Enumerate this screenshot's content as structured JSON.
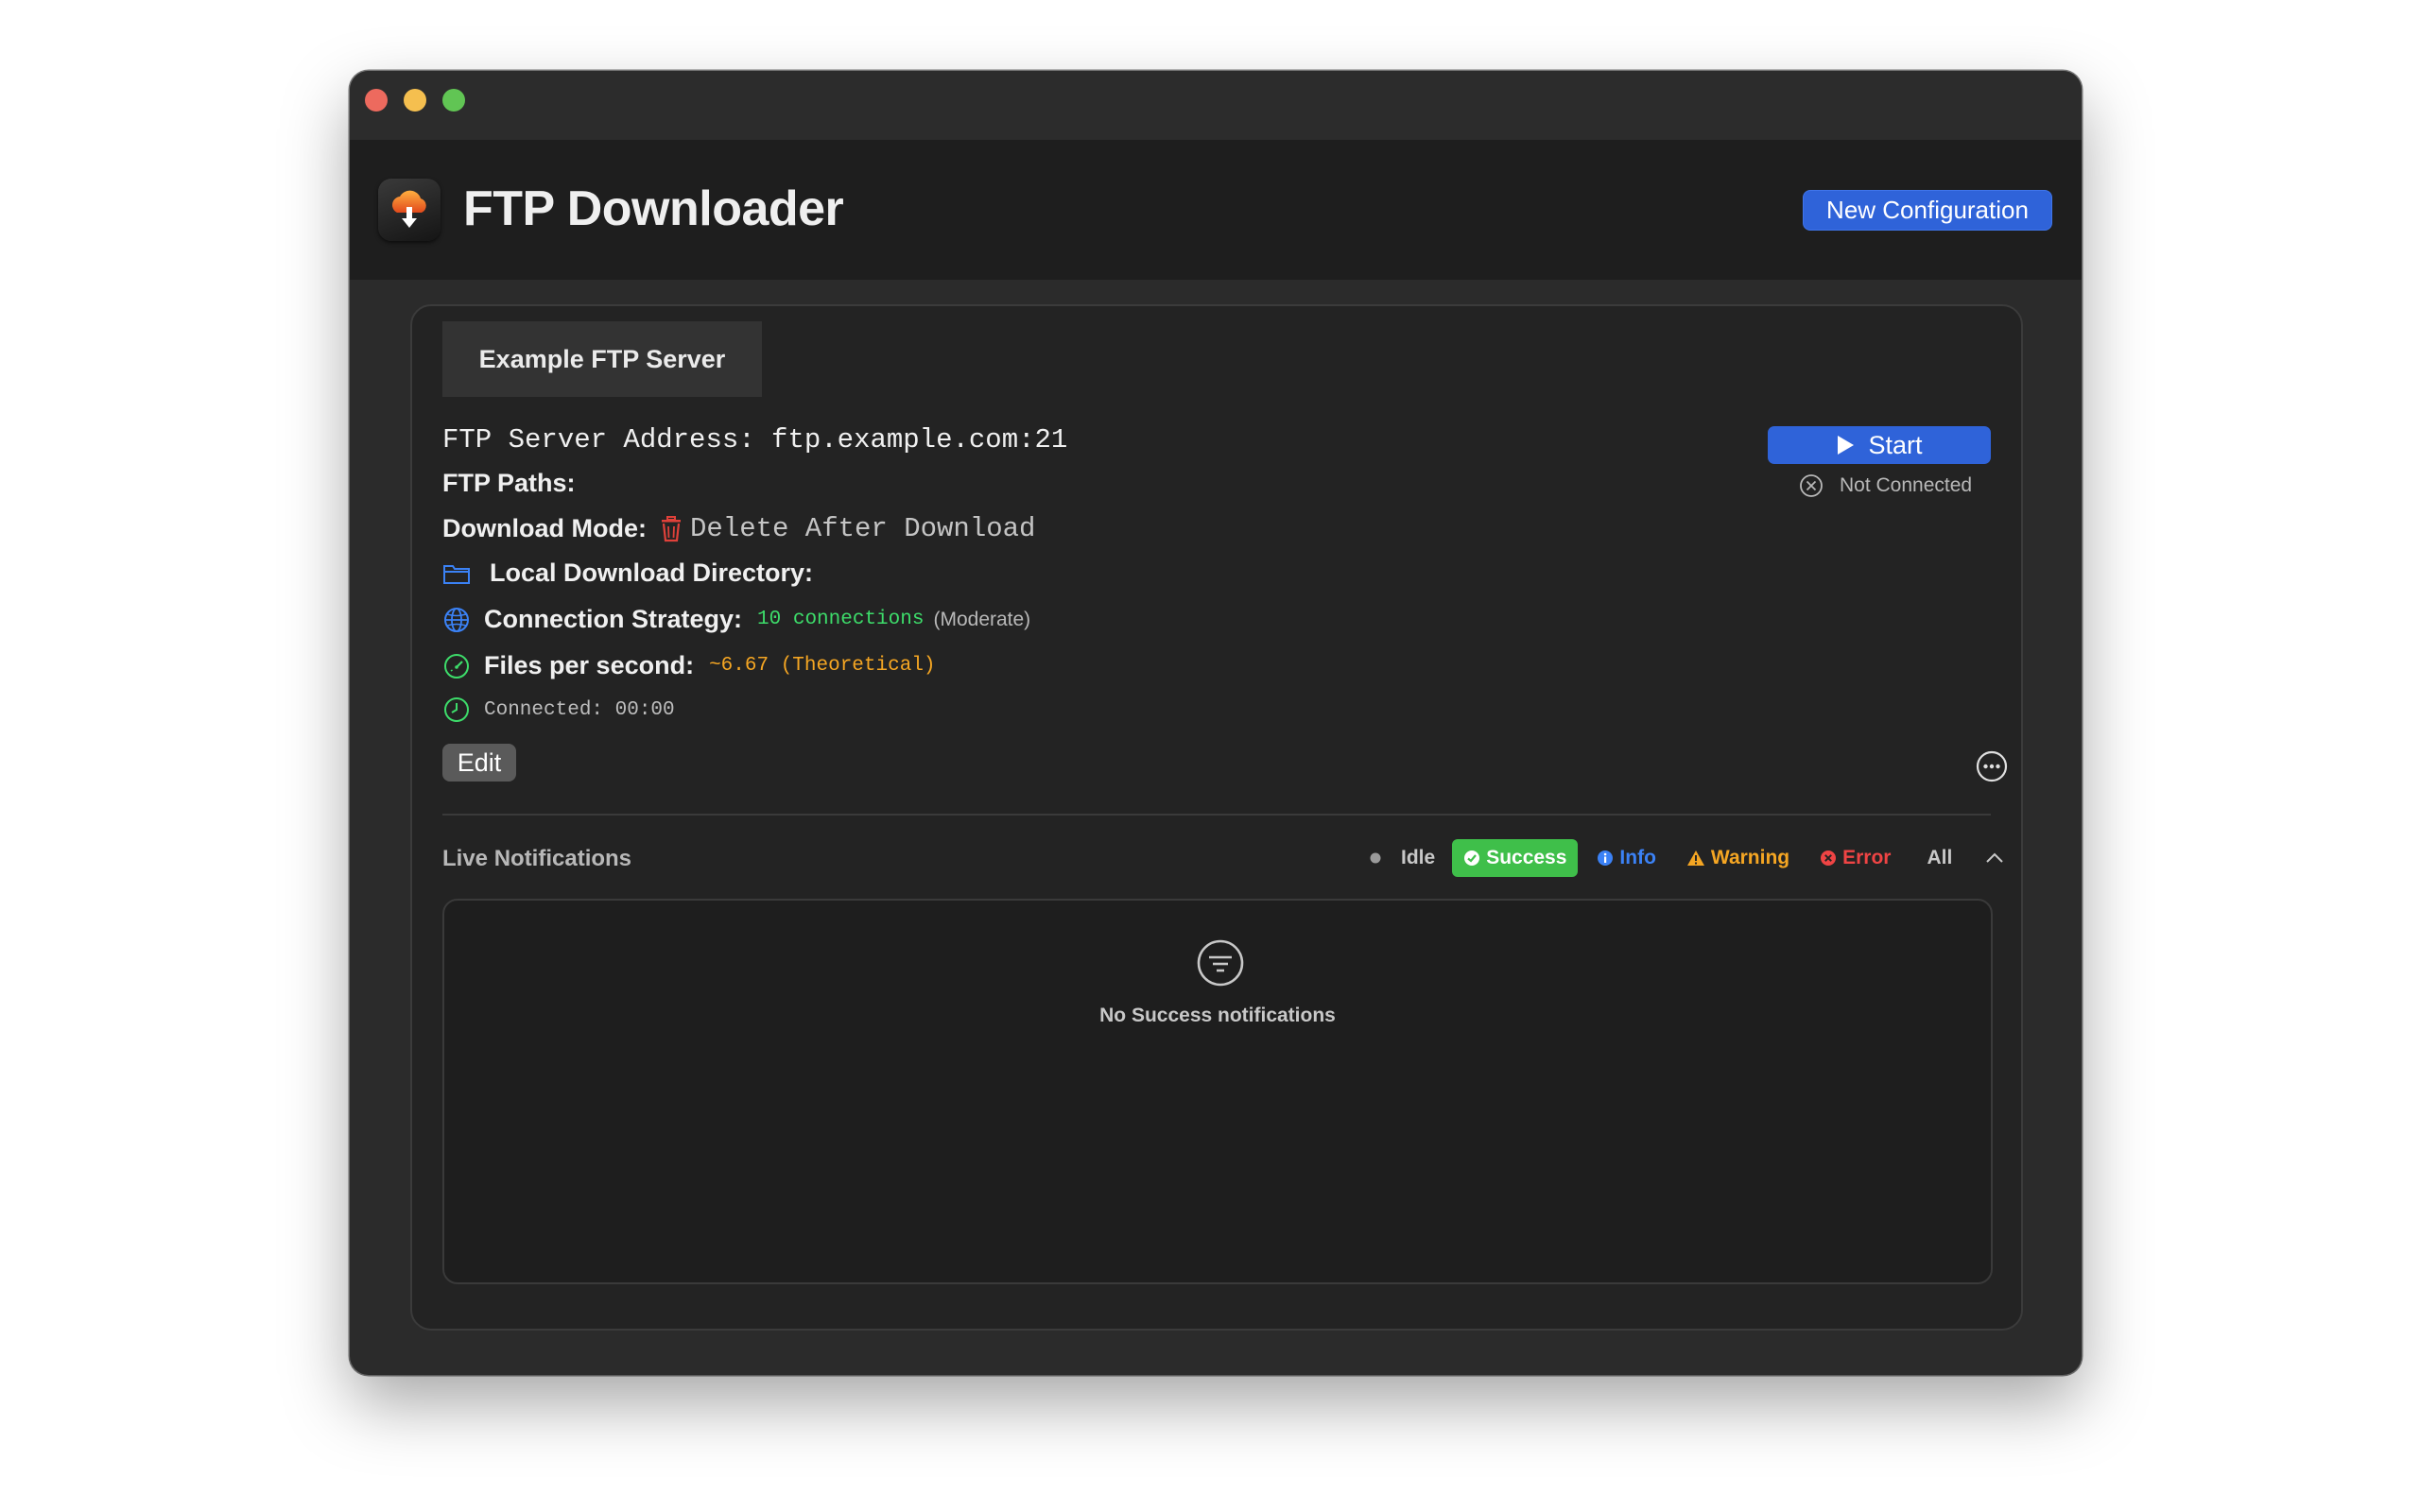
{
  "app": {
    "title": "FTP Downloader",
    "new_config_label": "New Configuration",
    "icon": "cloud-download-app-icon"
  },
  "config": {
    "tab_label": "Example FTP Server",
    "server_address": "FTP Server Address: ftp.example.com:21",
    "paths_label": "FTP Paths:",
    "download_mode_label": "Download Mode:",
    "download_mode_value": "Delete After Download",
    "local_dir_label": "Local Download Directory:",
    "strategy_label": "Connection Strategy:",
    "strategy_value": "10 connections",
    "strategy_note": "(Moderate)",
    "fps_label": "Files per second:",
    "fps_value": "~6.67 (Theoretical)",
    "connected_label": "Connected: 00:00",
    "edit_label": "Edit",
    "start_label": "Start",
    "status_label": "Not Connected"
  },
  "notifications": {
    "title": "Live Notifications",
    "filters": {
      "idle": "Idle",
      "success": "Success",
      "info": "Info",
      "warning": "Warning",
      "error": "Error",
      "all": "All"
    },
    "selected_filter": "Success",
    "empty_text": "No Success notifications"
  },
  "colors": {
    "accent": "#2f63d9",
    "success": "#3fbf4a",
    "info": "#3b82f6",
    "warning": "#f5a623",
    "error": "#ef4444",
    "connections_green": "#3ddc6a"
  }
}
